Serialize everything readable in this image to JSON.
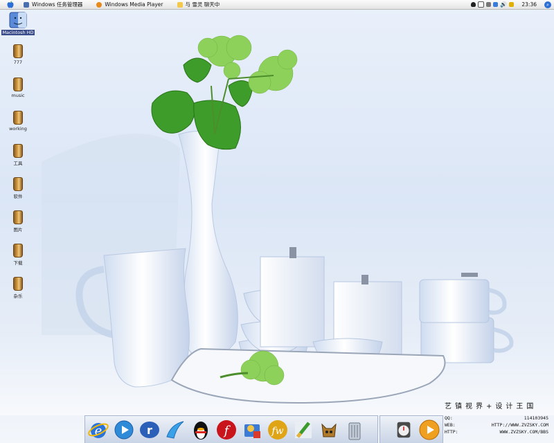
{
  "menubar": {
    "items": [
      {
        "label": "Windows 任务管理器",
        "icon": "task-manager-icon"
      },
      {
        "label": "Windows Media Player",
        "icon": "media-player-icon"
      },
      {
        "label": "与 雪灵 聊天中",
        "icon": "chat-icon"
      }
    ],
    "clock": "23:36"
  },
  "desktop_icons": [
    {
      "label": "Macintosh HD",
      "icon": "finder-icon",
      "selected": true
    },
    {
      "label": "777"
    },
    {
      "label": "music"
    },
    {
      "label": "working"
    },
    {
      "label": "工具"
    },
    {
      "label": "软件"
    },
    {
      "label": "图片"
    },
    {
      "label": "下载"
    },
    {
      "label": "杂乐"
    }
  ],
  "dock": [
    "internet-explorer-icon",
    "media-player-icon",
    "realplayer-icon",
    "messenger-icon",
    "qq-penguin-icon",
    "flash-icon",
    "image-viewer-icon",
    "dreamweaver-icon",
    "paint-brush-icon",
    "warrior-game-icon",
    "trash-icon"
  ],
  "dock_right": [
    "stopwatch-icon",
    "play-icon"
  ],
  "watermark": {
    "title": "艺镇视界+设计王国",
    "qq_label": "QQ:",
    "qq": "114103945",
    "web_label": "WEB:",
    "web": "HTTP://WWW.ZVZSKY.COM",
    "bbs_label": "HTTP:",
    "bbs": "WWW.ZVZSKY.COM/BBS"
  }
}
